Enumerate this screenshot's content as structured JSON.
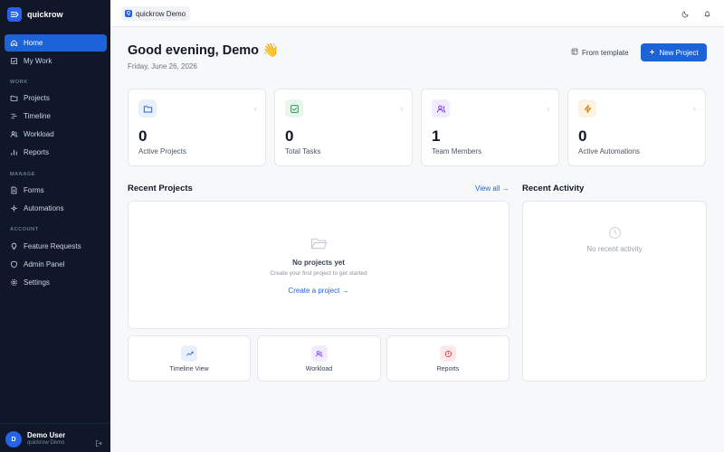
{
  "app": {
    "name": "quickrow"
  },
  "sidebar": {
    "items": [
      {
        "label": "Home",
        "icon": "home-icon",
        "active": true
      },
      {
        "label": "My Work",
        "icon": "checklist-icon"
      },
      {
        "label": "Projects",
        "icon": "folder-icon"
      },
      {
        "label": "Timeline",
        "icon": "timeline-icon"
      },
      {
        "label": "Workload",
        "icon": "users-icon"
      },
      {
        "label": "Reports",
        "icon": "bar-chart-icon"
      },
      {
        "label": "Forms",
        "icon": "document-icon"
      },
      {
        "label": "Automations",
        "icon": "automation-icon"
      },
      {
        "label": "Feature Requests",
        "icon": "lightbulb-icon"
      },
      {
        "label": "Admin Panel",
        "icon": "shield-icon"
      },
      {
        "label": "Settings",
        "icon": "gear-icon"
      }
    ],
    "sections": {
      "work": "WORK",
      "manage": "MANAGE",
      "account": "ACCOUNT"
    },
    "user": {
      "initial": "D",
      "name": "Demo User",
      "org": "quickrow Demo"
    }
  },
  "topbar": {
    "workspace_initial": "Q",
    "workspace": "quickrow Demo"
  },
  "header": {
    "greeting": "Good evening, Demo 👋",
    "date": "Friday, June 26, 2026",
    "template_label": "From template",
    "new_project_label": "New Project"
  },
  "stats": [
    {
      "value": "0",
      "label": "Active Projects",
      "color": "#2563eb",
      "bg": "#e8f0fe"
    },
    {
      "value": "0",
      "label": "Total Tasks",
      "color": "#16a34a",
      "bg": "#e7f7ec"
    },
    {
      "value": "1",
      "label": "Team Members",
      "color": "#7c3aed",
      "bg": "#f1ebfd"
    },
    {
      "value": "0",
      "label": "Active Automations",
      "color": "#d97706",
      "bg": "#fdf3e3"
    }
  ],
  "recent_projects": {
    "title": "Recent Projects",
    "view_all": "View all →",
    "empty_title": "No projects yet",
    "empty_sub": "Create your first project to get started",
    "create_link": "Create a project →"
  },
  "recent_activity": {
    "title": "Recent Activity",
    "empty": "No recent activity"
  },
  "quick_links": [
    {
      "label": "Timeline View",
      "color": "#2563eb",
      "bg": "#e8f0fe"
    },
    {
      "label": "Workload",
      "color": "#7c3aed",
      "bg": "#f1ebfd"
    },
    {
      "label": "Reports",
      "color": "#dc2626",
      "bg": "#fde8ea"
    }
  ]
}
